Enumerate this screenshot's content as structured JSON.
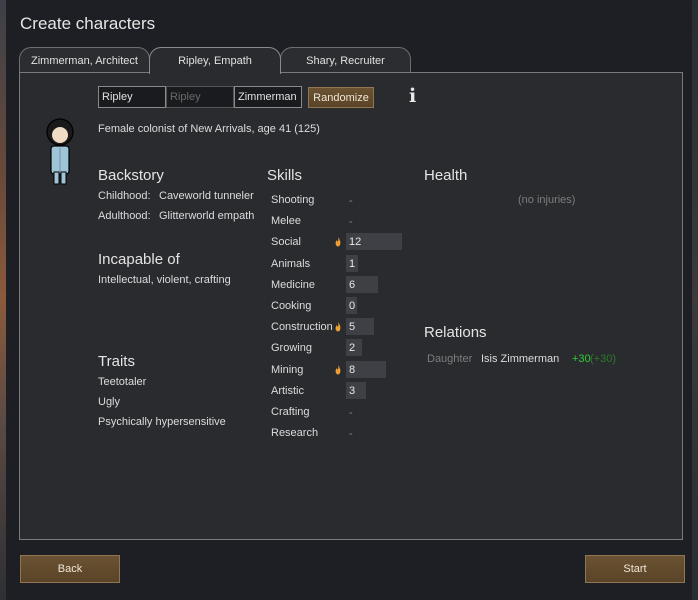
{
  "window": {
    "title": "Create characters"
  },
  "tabs": [
    {
      "label": "Zimmerman, Architect"
    },
    {
      "label": "Ripley, Empath"
    },
    {
      "label": "Shary, Recruiter"
    }
  ],
  "name_fields": {
    "first": "Ripley",
    "nick_placeholder": "Ripley",
    "last": "Zimmerman"
  },
  "randomize_label": "Randomize",
  "info_icon": "i",
  "description": "Female colonist of New Arrivals, age 41 (125)",
  "backstory": {
    "heading": "Backstory",
    "childhood_label": "Childhood:",
    "childhood_value": "Caveworld tunneler",
    "adulthood_label": "Adulthood:",
    "adulthood_value": "Glitterworld empath"
  },
  "incapable": {
    "heading": "Incapable of",
    "value": "Intellectual, violent, crafting"
  },
  "traits": {
    "heading": "Traits",
    "items": [
      "Teetotaler",
      "Ugly",
      "Psychically hypersensitive"
    ]
  },
  "skills": {
    "heading": "Skills",
    "max_level": 20,
    "items": [
      {
        "name": "Shooting",
        "value": "-",
        "passion": false
      },
      {
        "name": "Melee",
        "value": "-",
        "passion": false
      },
      {
        "name": "Social",
        "value": "12",
        "level": 12,
        "passion": true
      },
      {
        "name": "Animals",
        "value": "1",
        "level": 1,
        "passion": false
      },
      {
        "name": "Medicine",
        "value": "6",
        "level": 6,
        "passion": false
      },
      {
        "name": "Cooking",
        "value": "0",
        "level": 0,
        "passion": false
      },
      {
        "name": "Construction",
        "value": "5",
        "level": 5,
        "passion": true
      },
      {
        "name": "Growing",
        "value": "2",
        "level": 2,
        "passion": false
      },
      {
        "name": "Mining",
        "value": "8",
        "level": 8,
        "passion": true
      },
      {
        "name": "Artistic",
        "value": "3",
        "level": 3,
        "passion": false
      },
      {
        "name": "Crafting",
        "value": "-",
        "passion": false
      },
      {
        "name": "Research",
        "value": "-",
        "passion": false
      }
    ]
  },
  "health": {
    "heading": "Health",
    "status": "(no injuries)"
  },
  "relations": {
    "heading": "Relations",
    "items": [
      {
        "relation": "Daughter",
        "name": "Isis Zimmerman",
        "opinion": "+30",
        "opinion_other": "(+30)"
      }
    ]
  },
  "buttons": {
    "back": "Back",
    "start": "Start"
  },
  "colors": {
    "passion_flame": "#f0a030",
    "positive_opinion": "#33cc33",
    "button_bg": "#5e472b"
  }
}
